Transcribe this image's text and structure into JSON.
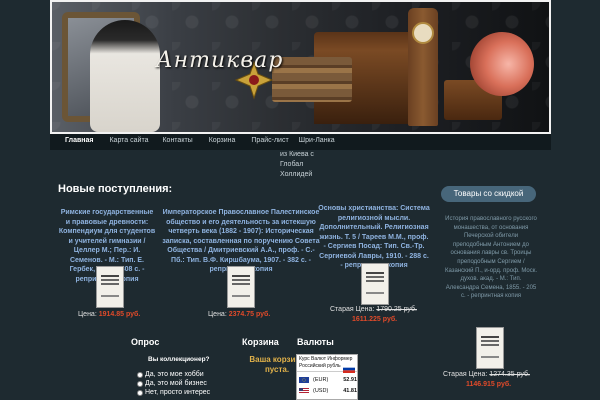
{
  "site": {
    "logo_text": "Антиквар"
  },
  "nav": {
    "items": [
      {
        "label": "Главная",
        "active": true
      },
      {
        "label": "Карта сайта"
      },
      {
        "label": "Контакты"
      },
      {
        "label": "Корзина"
      },
      {
        "label": "Прайс-лист"
      },
      {
        "label": "Шри-Ланка"
      }
    ],
    "subitems": [
      "из Киева с",
      "Глобал",
      "Холлидей"
    ]
  },
  "main": {
    "section_title": "Новые поступления:",
    "products": [
      {
        "title": "Римские государственные и правовые древности: Компендиум для студентов и учителей гимназии / Целлер М.; Пер.: И. Семенов. - М.: Тип. Е. Гербек, 1893. - 308 с. - репринтная копия",
        "price_label": "Цена:",
        "price": "1914.85 руб."
      },
      {
        "title": "Императорское Православное Палестинское общество и его деятельность за истекшую четверть века (1882 - 1907): Историческая записка, составленная по поручению Совета Общества / Дмитриевский А.А., проф. - С.-Пб.: Тип. В.Ф. Киршбаума, 1907. - 382 с. - репринтная копия",
        "price_label": "Цена:",
        "price": "2374.75 руб."
      },
      {
        "title": "Основы христианства: Система религиозной мысли. Дополнительный. Религиозная жизнь. Т. 5 / Тареев М.М., проф. - Сергиев Посад: Тип. Св.-Тр. Сергиевой Лавры, 1910. - 288 с. - репринтная копия",
        "price_label": "Старая Цена:",
        "old_price": "1790.25 руб.",
        "price": "1611.225 руб."
      }
    ]
  },
  "sidebar": {
    "discount_title": "Товары со скидкой",
    "discount_text": "История православного русского монашества, от основания Печерской обители преподобным Антонием до основания лавры св. Троицы преподобным Сергием / Казанский П., и-орд. проф. Моск. духов. акад. - М.: Тип. Александра Семена, 1855. - 205 с. - репринтная копия",
    "price_label": "Старая Цена:",
    "old_price": "1274.35 руб.",
    "price": "1146.915 руб."
  },
  "poll": {
    "title": "Опрос",
    "question": "Вы коллекционер?",
    "options": [
      "Да, это мое хобби",
      "Да, это мой бизнес",
      "Нет, просто интерес"
    ]
  },
  "cart": {
    "title": "Корзина",
    "text": "Ваша корзина пуста."
  },
  "currency": {
    "title": "Валюты",
    "header": "Курс Валют Информер Российский рубль",
    "rates": [
      {
        "code": "(EUR)",
        "value": "52.91"
      },
      {
        "code": "(USD)",
        "value": "41.81"
      }
    ]
  },
  "colors": {
    "background": "#1e2a30",
    "link": "#8fb3e0",
    "price": "#e04a2a",
    "cart_accent": "#e2b24a",
    "badge": "#47667a"
  }
}
